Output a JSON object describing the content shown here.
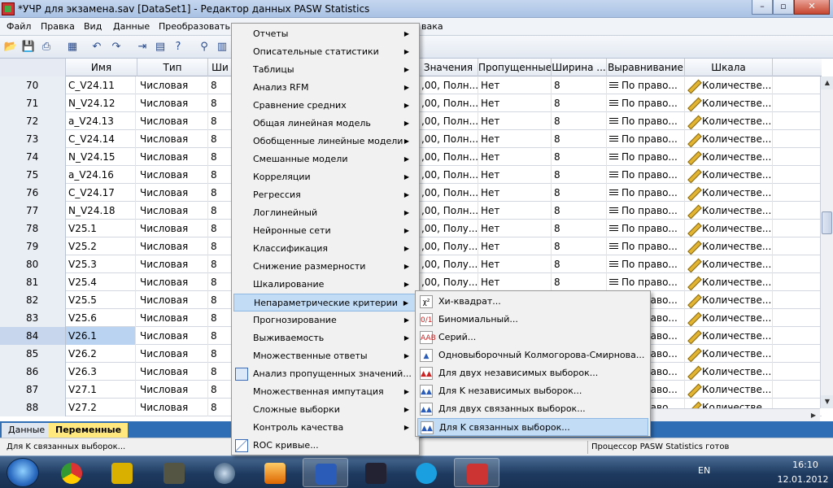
{
  "window": {
    "title": "*УЧР для экзамена.sav [DataSet1] - Редактор данных PASW Statistics",
    "min_label": "–",
    "max_label": "▫",
    "close_label": "✕"
  },
  "menubar": [
    "Файл",
    "Правка",
    "Вид",
    "Данные",
    "Преобразовать",
    "вака"
  ],
  "columns": [
    "Имя",
    "Тип",
    "Ши",
    "Значения",
    "Пропущенные",
    "Ширина ...",
    "Выравнивание",
    "Шкала"
  ],
  "rows": [
    {
      "n": "70",
      "name": "C_V24.11",
      "type": "Числовая",
      "w": "8",
      "values": ",00, Полн...",
      "missing": "Нет",
      "width": "8",
      "align": "По право...",
      "scale": "Количестве..."
    },
    {
      "n": "71",
      "name": "N_V24.12",
      "type": "Числовая",
      "w": "8",
      "values": ",00, Полн...",
      "missing": "Нет",
      "width": "8",
      "align": "По право...",
      "scale": "Количестве..."
    },
    {
      "n": "72",
      "name": "a_V24.13",
      "type": "Числовая",
      "w": "8",
      "values": ",00, Полн...",
      "missing": "Нет",
      "width": "8",
      "align": "По право...",
      "scale": "Количестве..."
    },
    {
      "n": "73",
      "name": "C_V24.14",
      "type": "Числовая",
      "w": "8",
      "values": ",00, Полн...",
      "missing": "Нет",
      "width": "8",
      "align": "По право...",
      "scale": "Количестве..."
    },
    {
      "n": "74",
      "name": "N_V24.15",
      "type": "Числовая",
      "w": "8",
      "values": ",00, Полн...",
      "missing": "Нет",
      "width": "8",
      "align": "По право...",
      "scale": "Количестве..."
    },
    {
      "n": "75",
      "name": "a_V24.16",
      "type": "Числовая",
      "w": "8",
      "values": ",00, Полн...",
      "missing": "Нет",
      "width": "8",
      "align": "По право...",
      "scale": "Количестве..."
    },
    {
      "n": "76",
      "name": "C_V24.17",
      "type": "Числовая",
      "w": "8",
      "values": ",00, Полн...",
      "missing": "Нет",
      "width": "8",
      "align": "По право...",
      "scale": "Количестве..."
    },
    {
      "n": "77",
      "name": "N_V24.18",
      "type": "Числовая",
      "w": "8",
      "values": ",00, Полн...",
      "missing": "Нет",
      "width": "8",
      "align": "По право...",
      "scale": "Количестве..."
    },
    {
      "n": "78",
      "name": "V25.1",
      "type": "Числовая",
      "w": "8",
      "values": ",00, Полу...",
      "missing": "Нет",
      "width": "8",
      "align": "По право...",
      "scale": "Количестве..."
    },
    {
      "n": "79",
      "name": "V25.2",
      "type": "Числовая",
      "w": "8",
      "values": ",00, Полу...",
      "missing": "Нет",
      "width": "8",
      "align": "По право...",
      "scale": "Количестве..."
    },
    {
      "n": "80",
      "name": "V25.3",
      "type": "Числовая",
      "w": "8",
      "values": ",00, Полу...",
      "missing": "Нет",
      "width": "8",
      "align": "По право...",
      "scale": "Количестве..."
    },
    {
      "n": "81",
      "name": "V25.4",
      "type": "Числовая",
      "w": "8",
      "values": ",00, Полу...",
      "missing": "Нет",
      "width": "8",
      "align": "По право...",
      "scale": "Количестве..."
    },
    {
      "n": "82",
      "name": "V25.5",
      "type": "Числовая",
      "w": "8",
      "values": "",
      "missing": "",
      "width": "",
      "align": "По право...",
      "scale": "Количестве..."
    },
    {
      "n": "83",
      "name": "V25.6",
      "type": "Числовая",
      "w": "8",
      "values": "",
      "missing": "",
      "width": "",
      "align": "По право...",
      "scale": "Количестве..."
    },
    {
      "n": "84",
      "name": "V26.1",
      "type": "Числовая",
      "w": "8",
      "values": "",
      "missing": "",
      "width": "",
      "align": "По право...",
      "scale": "Количестве..."
    },
    {
      "n": "85",
      "name": "V26.2",
      "type": "Числовая",
      "w": "8",
      "values": "",
      "missing": "",
      "width": "",
      "align": "По право...",
      "scale": "Количестве..."
    },
    {
      "n": "86",
      "name": "V26.3",
      "type": "Числовая",
      "w": "8",
      "values": "",
      "missing": "",
      "width": "",
      "align": "По право...",
      "scale": "Количестве..."
    },
    {
      "n": "87",
      "name": "V27.1",
      "type": "Числовая",
      "w": "8",
      "values": "",
      "missing": "",
      "width": "",
      "align": "По право...",
      "scale": "Количестве..."
    },
    {
      "n": "88",
      "name": "V27.2",
      "type": "Числовая",
      "w": "8",
      "values": "",
      "missing": "",
      "width": "",
      "align": "По право...",
      "scale": "Количестве..."
    }
  ],
  "selected_row": "84",
  "menu_items": [
    {
      "label": "Отчеты",
      "arrow": true
    },
    {
      "label": "Описательные статистики",
      "arrow": true
    },
    {
      "label": "Таблицы",
      "arrow": true
    },
    {
      "label": "Анализ RFM",
      "arrow": true
    },
    {
      "label": "Сравнение средних",
      "arrow": true
    },
    {
      "label": "Общая линейная модель",
      "arrow": true
    },
    {
      "label": "Обобщенные линейные модели",
      "arrow": true
    },
    {
      "label": "Смешанные модели",
      "arrow": true
    },
    {
      "label": "Корреляции",
      "arrow": true
    },
    {
      "label": "Регрессия",
      "arrow": true
    },
    {
      "label": "Логлинейный",
      "arrow": true
    },
    {
      "label": "Нейронные сети",
      "arrow": true
    },
    {
      "label": "Классификация",
      "arrow": true
    },
    {
      "label": "Снижение размерности",
      "arrow": true
    },
    {
      "label": "Шкалирование",
      "arrow": true
    },
    {
      "label": "Непараметрические критерии",
      "arrow": true,
      "highlighted": true
    },
    {
      "label": "Прогнозирование",
      "arrow": true
    },
    {
      "label": "Выживаемость",
      "arrow": true
    },
    {
      "label": "Множественные ответы",
      "arrow": true
    },
    {
      "label": "Анализ пропущенных значений...",
      "arrow": false,
      "icon": "missing-values-icon"
    },
    {
      "label": "Множественная импутация",
      "arrow": true
    },
    {
      "label": "Сложные выборки",
      "arrow": true
    },
    {
      "label": "Контроль качества",
      "arrow": true
    },
    {
      "label": "ROC кривые...",
      "arrow": false,
      "icon": "roc-curve-icon"
    }
  ],
  "submenu_items": [
    {
      "label": "Хи-квадрат...",
      "icon": "chi-square-icon",
      "glyph": "χ²"
    },
    {
      "label": "Биномиальный...",
      "icon": "binomial-icon",
      "glyph": "0/1"
    },
    {
      "label": "Серий...",
      "icon": "runs-icon",
      "glyph": "AAB"
    },
    {
      "label": "Одновыборочный Колмогорова-Смирнова...",
      "icon": "one-sample-ks-icon",
      "glyph": "▲"
    },
    {
      "label": "Для двух независимых выборок...",
      "icon": "two-independent-samples-icon",
      "glyph": "▲▲"
    },
    {
      "label": "Для K независимых выборок...",
      "icon": "k-independent-samples-icon",
      "glyph": "▲▲"
    },
    {
      "label": "Для двух связанных выборок...",
      "icon": "two-related-samples-icon",
      "glyph": "▲▲"
    },
    {
      "label": "Для K связанных выборок...",
      "icon": "k-related-samples-icon",
      "glyph": "▲▲",
      "highlighted": true
    }
  ],
  "tabs": {
    "data": "Данные",
    "variables": "Переменные"
  },
  "status": {
    "left": "Для K связанных выборок...",
    "right": "Процессор PASW Statistics  готов"
  },
  "tray": {
    "lang": "EN",
    "time": "16:10",
    "date": "12.01.2012"
  },
  "colors": {
    "menu_highlight": "#c2dcf5",
    "tab_active": "#ffe97f",
    "tab_strip": "#2f6db5"
  }
}
